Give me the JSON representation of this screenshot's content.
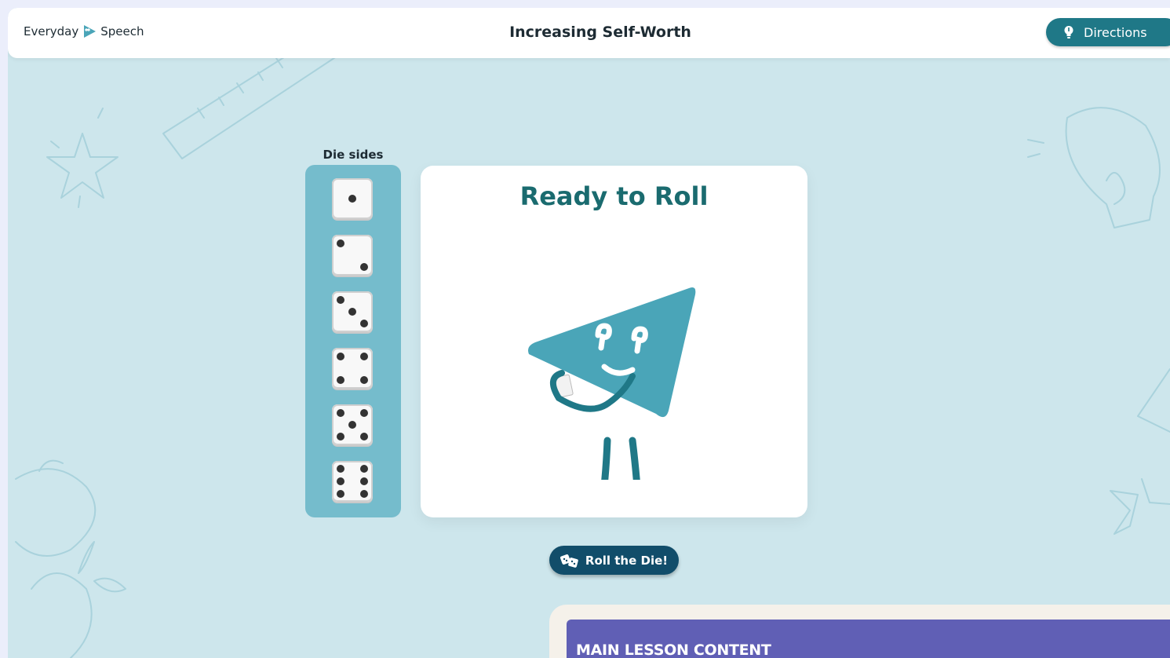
{
  "header": {
    "logo": {
      "left_text": "Everyday",
      "right_text": "Speech"
    },
    "title": "Increasing Self-Worth",
    "directions_label": "Directions"
  },
  "die_sides": {
    "label": "Die sides",
    "faces": [
      1,
      2,
      3,
      4,
      5,
      6
    ]
  },
  "roll_card": {
    "status": "Ready to Roll",
    "mascot": "triangle-character-icon"
  },
  "roll_button": {
    "label": "Roll the Die!",
    "icon": "dice-icon"
  },
  "lesson": {
    "banner_title": "MAIN LESSON CONTENT"
  },
  "colors": {
    "background": "#cde6ec",
    "primary_button": "#1f7887",
    "roll_button": "#114d6a",
    "die_panel": "#75bccc",
    "heading": "#1a6b6f",
    "mascot": "#4aa5b8",
    "lesson_banner": "#605fb5"
  }
}
